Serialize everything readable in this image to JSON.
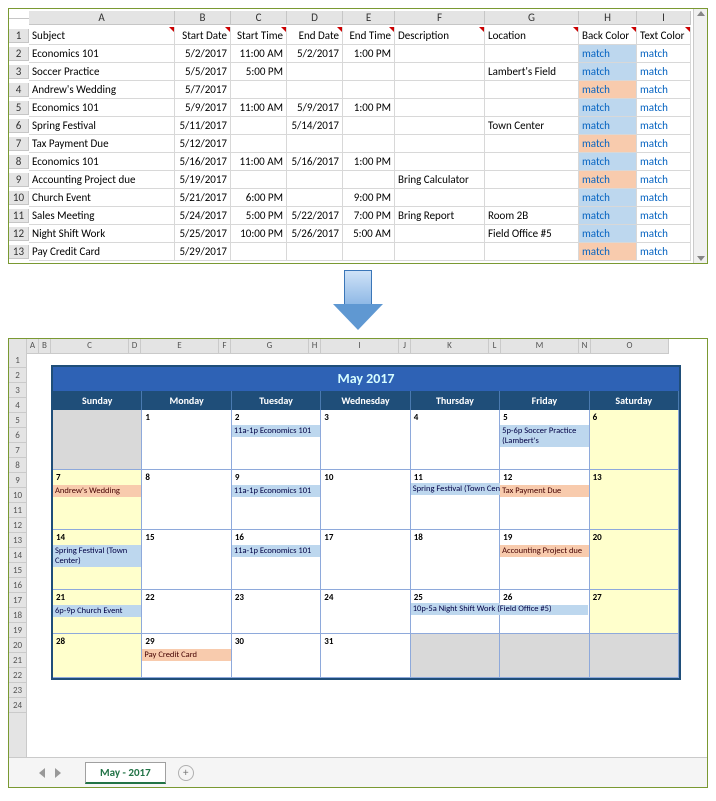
{
  "sheet1": {
    "cols": [
      "",
      "A",
      "B",
      "C",
      "D",
      "E",
      "F",
      "G",
      "H",
      "I"
    ],
    "headers": [
      "Subject",
      "Start Date",
      "Start Time",
      "End Date",
      "End Time",
      "Description",
      "Location",
      "Back Color",
      "Text Color"
    ],
    "rows": [
      {
        "n": "1"
      },
      {
        "n": "2",
        "subject": "Economics 101",
        "sd": "5/2/2017",
        "st": "11:00 AM",
        "ed": "5/2/2017",
        "et": "1:00 PM",
        "desc": "",
        "loc": "",
        "bc": "blue"
      },
      {
        "n": "3",
        "subject": "Soccer Practice",
        "sd": "5/5/2017",
        "st": "5:00 PM",
        "ed": "",
        "et": "",
        "desc": "",
        "loc": "Lambert's Field",
        "bc": "blue"
      },
      {
        "n": "4",
        "subject": "Andrew's Wedding",
        "sd": "5/7/2017",
        "st": "",
        "ed": "",
        "et": "",
        "desc": "",
        "loc": "",
        "bc": "orange"
      },
      {
        "n": "5",
        "subject": "Economics 101",
        "sd": "5/9/2017",
        "st": "11:00 AM",
        "ed": "5/9/2017",
        "et": "1:00 PM",
        "desc": "",
        "loc": "",
        "bc": "blue"
      },
      {
        "n": "6",
        "subject": "Spring Festival",
        "sd": "5/11/2017",
        "st": "",
        "ed": "5/14/2017",
        "et": "",
        "desc": "",
        "loc": "Town Center",
        "bc": "blue"
      },
      {
        "n": "7",
        "subject": "Tax Payment Due",
        "sd": "5/12/2017",
        "st": "",
        "ed": "",
        "et": "",
        "desc": "",
        "loc": "",
        "bc": "orange"
      },
      {
        "n": "8",
        "subject": "Economics 101",
        "sd": "5/16/2017",
        "st": "11:00 AM",
        "ed": "5/16/2017",
        "et": "1:00 PM",
        "desc": "",
        "loc": "",
        "bc": "blue"
      },
      {
        "n": "9",
        "subject": "Accounting Project due",
        "sd": "5/19/2017",
        "st": "",
        "ed": "",
        "et": "",
        "desc": "Bring Calculator",
        "loc": "",
        "bc": "orange"
      },
      {
        "n": "10",
        "subject": "Church Event",
        "sd": "5/21/2017",
        "st": "6:00 PM",
        "ed": "",
        "et": "9:00 PM",
        "desc": "",
        "loc": "",
        "bc": "blue"
      },
      {
        "n": "11",
        "subject": "Sales Meeting",
        "sd": "5/24/2017",
        "st": "5:00 PM",
        "ed": "5/22/2017",
        "et": "7:00 PM",
        "desc": "Bring Report",
        "loc": "Room 2B",
        "bc": "blue"
      },
      {
        "n": "12",
        "subject": "Night Shift Work",
        "sd": "5/25/2017",
        "st": "10:00 PM",
        "ed": "5/26/2017",
        "et": "5:00 AM",
        "desc": "",
        "loc": "Field Office #5",
        "bc": "blue"
      },
      {
        "n": "13",
        "subject": "Pay Credit Card",
        "sd": "5/29/2017",
        "st": "",
        "ed": "",
        "et": "",
        "desc": "",
        "loc": "",
        "bc": "orange"
      }
    ],
    "match": "match"
  },
  "sheet2": {
    "tab": "May - 2017",
    "miniCols": [
      "",
      "A",
      "B",
      "C",
      "D",
      "E",
      "F",
      "G",
      "H",
      "I",
      "J",
      "K",
      "L",
      "M",
      "N",
      "O"
    ],
    "miniRows": [
      "1",
      "2",
      "3",
      "4",
      "5",
      "6",
      "7",
      "8",
      "9",
      "10",
      "11",
      "12",
      "13",
      "14",
      "15",
      "16",
      "17",
      "18",
      "19",
      "20",
      "21",
      "22",
      "23",
      "24"
    ],
    "calendar": {
      "title": "May 2017",
      "dayheads": [
        "Sunday",
        "Monday",
        "Tuesday",
        "Wednesday",
        "Thursday",
        "Friday",
        "Saturday"
      ],
      "weeks": [
        [
          {
            "num": "",
            "cls": "disabled"
          },
          {
            "num": "1"
          },
          {
            "num": "2",
            "events": [
              {
                "t": "11a-1p Economics 101",
                "c": "blue"
              }
            ]
          },
          {
            "num": "3"
          },
          {
            "num": "4"
          },
          {
            "num": "5",
            "events": [
              {
                "t": "5p-6p Soccer Practice (Lambert's",
                "c": "blue"
              }
            ]
          },
          {
            "num": "6",
            "cls": "weekend"
          }
        ],
        [
          {
            "num": "7",
            "cls": "weekend",
            "events": [
              {
                "t": "Andrew's Wedding",
                "c": "orange"
              }
            ]
          },
          {
            "num": "8"
          },
          {
            "num": "9",
            "events": [
              {
                "t": "11a-1p Economics 101",
                "c": "blue"
              }
            ]
          },
          {
            "num": "10"
          },
          {
            "num": "11",
            "span": 2,
            "events": [
              {
                "t": "Spring Festival (Town Center)",
                "c": "blue"
              }
            ]
          },
          {
            "num": "12",
            "events": [
              {
                "t": "Tax Payment Due",
                "c": "orange"
              }
            ]
          },
          {
            "num": "13",
            "cls": "weekend"
          }
        ],
        [
          {
            "num": "14",
            "cls": "weekend",
            "events": [
              {
                "t": "Spring Festival (Town Center)",
                "c": "blue"
              }
            ]
          },
          {
            "num": "15"
          },
          {
            "num": "16",
            "events": [
              {
                "t": "11a-1p Economics 101",
                "c": "blue"
              }
            ]
          },
          {
            "num": "17"
          },
          {
            "num": "18"
          },
          {
            "num": "19",
            "events": [
              {
                "t": "Accounting Project due",
                "c": "orange"
              }
            ]
          },
          {
            "num": "20",
            "cls": "weekend"
          }
        ],
        [
          {
            "num": "21",
            "cls": "weekend",
            "events": [
              {
                "t": "6p-9p Church Event",
                "c": "blue"
              }
            ]
          },
          {
            "num": "22"
          },
          {
            "num": "23"
          },
          {
            "num": "24"
          },
          {
            "num": "25",
            "span": 2,
            "events": [
              {
                "t": "10p-5a Night Shift Work (Field Office #5)",
                "c": "blue"
              }
            ]
          },
          {
            "num": "26"
          },
          {
            "num": "27",
            "cls": "weekend"
          }
        ],
        [
          {
            "num": "28",
            "cls": "weekend"
          },
          {
            "num": "29",
            "events": [
              {
                "t": "Pay Credit Card",
                "c": "orange"
              }
            ]
          },
          {
            "num": "30"
          },
          {
            "num": "31"
          },
          {
            "num": "",
            "cls": "disabled"
          },
          {
            "num": "",
            "cls": "disabled"
          },
          {
            "num": "",
            "cls": "disabled"
          }
        ]
      ]
    }
  }
}
